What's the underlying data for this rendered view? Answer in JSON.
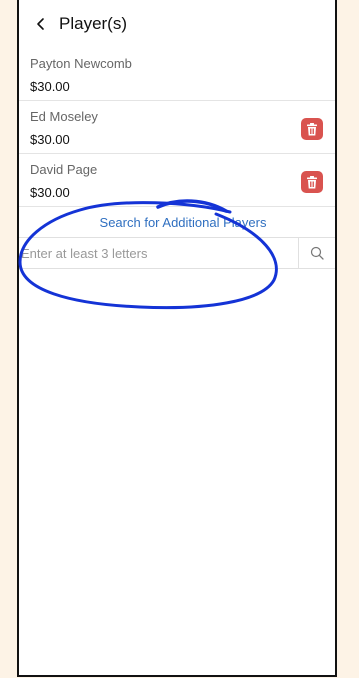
{
  "header": {
    "title": "Player(s)",
    "back_icon": "chevron-left-icon"
  },
  "players": [
    {
      "name": "Payton Newcomb",
      "amount": "$30.00",
      "deletable": false
    },
    {
      "name": "Ed Moseley",
      "amount": "$30.00",
      "deletable": true
    },
    {
      "name": "David Page",
      "amount": "$30.00",
      "deletable": true
    }
  ],
  "search": {
    "link_label": "Search for Additional Players",
    "placeholder": "Enter at least 3 letters",
    "value": "",
    "icon": "search-icon"
  },
  "colors": {
    "page_background": "#fdf3e6",
    "link": "#2f6fc0",
    "delete_button": "#d9534f",
    "annotation_ink": "#1433d6"
  },
  "annotation": {
    "type": "hand-drawn circle around search field"
  }
}
